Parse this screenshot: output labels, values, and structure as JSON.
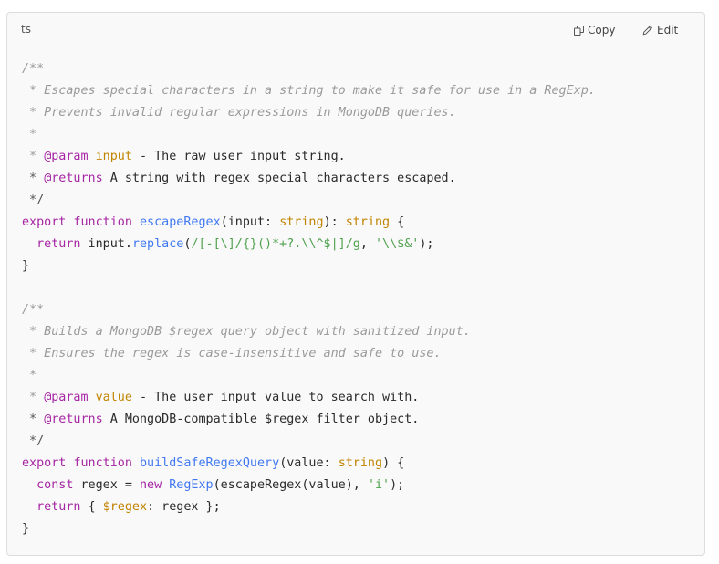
{
  "header": {
    "language": "ts",
    "copy_label": "Copy",
    "edit_label": "Edit"
  },
  "code_lines": [
    [
      {
        "t": "/**",
        "c": "cm"
      }
    ],
    [
      {
        "t": " * Escapes special characters in a string to make it safe for use in a RegExp.",
        "c": "cm"
      }
    ],
    [
      {
        "t": " * Prevents invalid regular expressions in MongoDB queries.",
        "c": "cm"
      }
    ],
    [
      {
        "t": " *",
        "c": "cm"
      }
    ],
    [
      {
        "t": " * ",
        "c": "cm"
      },
      {
        "t": "@param",
        "c": "tg"
      },
      {
        "t": " ",
        "c": "tx"
      },
      {
        "t": "input",
        "c": "pm"
      },
      {
        "t": " - The raw user input string.",
        "c": "tx"
      }
    ],
    [
      {
        "t": " * ",
        "c": "cn"
      },
      {
        "t": "@returns",
        "c": "tg"
      },
      {
        "t": " A string with regex special characters escaped.",
        "c": "tx"
      }
    ],
    [
      {
        "t": " */",
        "c": "cn"
      }
    ],
    [
      {
        "t": "export",
        "c": "kw"
      },
      {
        "t": " ",
        "c": "tx"
      },
      {
        "t": "function",
        "c": "kw"
      },
      {
        "t": " ",
        "c": "tx"
      },
      {
        "t": "escapeRegex",
        "c": "fn"
      },
      {
        "t": "(input: ",
        "c": "tx"
      },
      {
        "t": "string",
        "c": "ty"
      },
      {
        "t": "): ",
        "c": "tx"
      },
      {
        "t": "string",
        "c": "ty"
      },
      {
        "t": " {",
        "c": "tx"
      }
    ],
    [
      {
        "t": "  ",
        "c": "tx"
      },
      {
        "t": "return",
        "c": "kw"
      },
      {
        "t": " input.",
        "c": "tx"
      },
      {
        "t": "replace",
        "c": "fn"
      },
      {
        "t": "(",
        "c": "tx"
      },
      {
        "t": "/[-[\\]/{}()*+?.\\\\^$|]/g",
        "c": "st"
      },
      {
        "t": ", ",
        "c": "tx"
      },
      {
        "t": "'\\\\$&'",
        "c": "st"
      },
      {
        "t": ");",
        "c": "tx"
      }
    ],
    [
      {
        "t": "}",
        "c": "tx"
      }
    ],
    [],
    [
      {
        "t": "/**",
        "c": "cm"
      }
    ],
    [
      {
        "t": " * Builds a MongoDB $regex query object with sanitized input.",
        "c": "cm"
      }
    ],
    [
      {
        "t": " * Ensures the regex is case-insensitive and safe to use.",
        "c": "cm"
      }
    ],
    [
      {
        "t": " *",
        "c": "cm"
      }
    ],
    [
      {
        "t": " * ",
        "c": "cm"
      },
      {
        "t": "@param",
        "c": "tg"
      },
      {
        "t": " ",
        "c": "tx"
      },
      {
        "t": "value",
        "c": "pm"
      },
      {
        "t": " - The user input value to search with.",
        "c": "tx"
      }
    ],
    [
      {
        "t": " * ",
        "c": "cn"
      },
      {
        "t": "@returns",
        "c": "tg"
      },
      {
        "t": " A MongoDB-compatible $regex filter object.",
        "c": "tx"
      }
    ],
    [
      {
        "t": " */",
        "c": "cn"
      }
    ],
    [
      {
        "t": "export",
        "c": "kw"
      },
      {
        "t": " ",
        "c": "tx"
      },
      {
        "t": "function",
        "c": "kw"
      },
      {
        "t": " ",
        "c": "tx"
      },
      {
        "t": "buildSafeRegexQuery",
        "c": "fn"
      },
      {
        "t": "(value: ",
        "c": "tx"
      },
      {
        "t": "string",
        "c": "ty"
      },
      {
        "t": ") {",
        "c": "tx"
      }
    ],
    [
      {
        "t": "  ",
        "c": "tx"
      },
      {
        "t": "const",
        "c": "kw"
      },
      {
        "t": " regex = ",
        "c": "tx"
      },
      {
        "t": "new",
        "c": "kw"
      },
      {
        "t": " ",
        "c": "tx"
      },
      {
        "t": "RegExp",
        "c": "fn"
      },
      {
        "t": "(escapeRegex(value), ",
        "c": "tx"
      },
      {
        "t": "'i'",
        "c": "st"
      },
      {
        "t": ");",
        "c": "tx"
      }
    ],
    [
      {
        "t": "  ",
        "c": "tx"
      },
      {
        "t": "return",
        "c": "kw"
      },
      {
        "t": " { ",
        "c": "tx"
      },
      {
        "t": "$regex",
        "c": "pm"
      },
      {
        "t": ": regex };",
        "c": "tx"
      }
    ],
    [
      {
        "t": "}",
        "c": "tx"
      }
    ]
  ]
}
